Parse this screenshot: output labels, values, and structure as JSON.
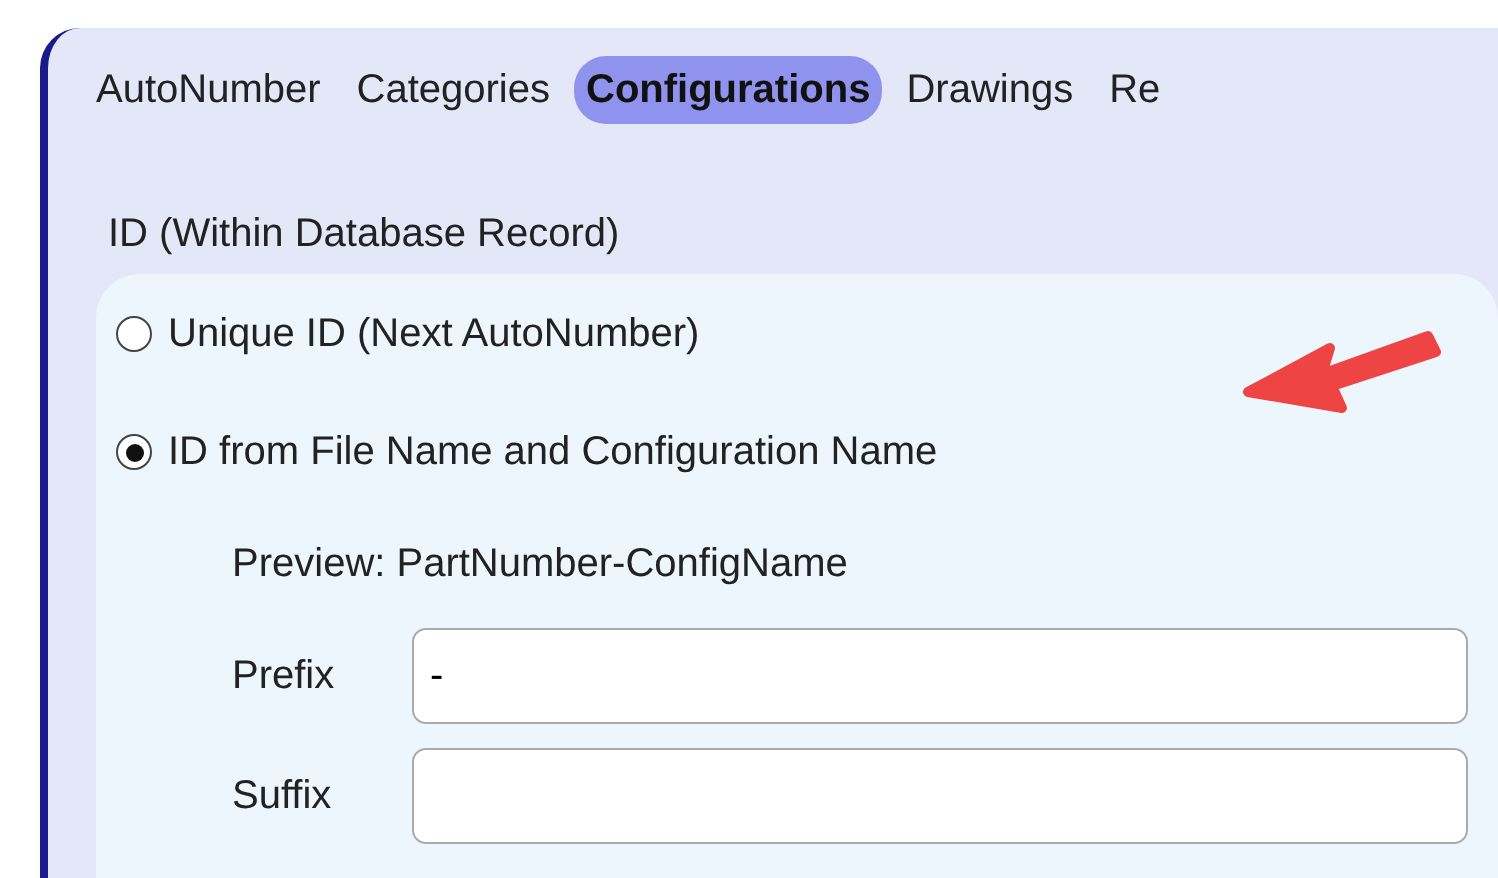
{
  "tabs": [
    {
      "label": "AutoNumber",
      "selected": false
    },
    {
      "label": "Categories",
      "selected": false
    },
    {
      "label": "Configurations",
      "selected": true
    },
    {
      "label": "Drawings",
      "selected": false
    },
    {
      "label": "Re",
      "selected": false
    }
  ],
  "group": {
    "title": "ID (Within Database Record)",
    "options": [
      {
        "label": "Unique ID (Next AutoNumber)",
        "selected": false
      },
      {
        "label": "ID from File Name and Configuration Name",
        "selected": true
      }
    ],
    "preview": "Preview: PartNumber-ConfigName",
    "fields": [
      {
        "label": "Prefix",
        "value": "-"
      },
      {
        "label": "Suffix"
      }
    ]
  }
}
